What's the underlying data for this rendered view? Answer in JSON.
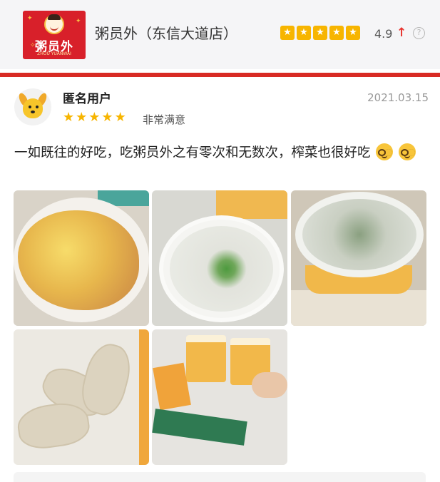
{
  "store": {
    "logo_text": "粥员外",
    "logo_subtext": "ZHOU YUANWAI",
    "name": "粥员外（东信大道店）",
    "rating": "4.9",
    "header_star_count": 5,
    "trend_icon": "up-arrow-icon",
    "help_icon": "question-mark-icon"
  },
  "review": {
    "username": "匿名用户",
    "date": "2021.03.15",
    "stars": 5,
    "satisfaction": "非常满意",
    "text": "一如既往的好吃，吃粥员外之有零次和无数次，榨菜也很好吃",
    "emoji_count": 2,
    "emoji_icon": "nerd-face-emoji",
    "photo_count": 5
  },
  "colors": {
    "accent_red": "#d82a24",
    "star_yellow": "#f7b500",
    "trend_red": "#e8332e"
  }
}
